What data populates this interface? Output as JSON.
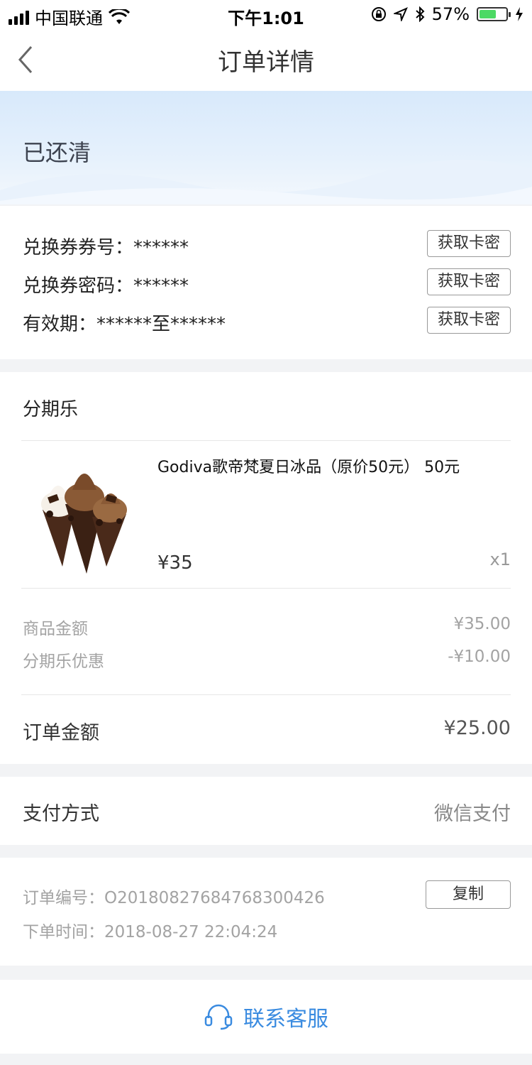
{
  "status_bar": {
    "carrier": "中国联通",
    "time": "下午1:01",
    "battery": "57%"
  },
  "nav": {
    "title": "订单详情"
  },
  "banner": {
    "status": "已还清"
  },
  "voucher": {
    "rows": [
      {
        "label": "兑换券券号：******",
        "button": "获取卡密"
      },
      {
        "label": "兑换券密码：******",
        "button": "获取卡密"
      },
      {
        "label": "有效期：******至******",
        "button": "获取卡密"
      }
    ]
  },
  "product_section": {
    "title": "分期乐",
    "product_name": "Godiva歌帝梵夏日冰品（原价50元） 50元",
    "price": "¥35",
    "quantity": "x1"
  },
  "summary": {
    "goods_amount_label": "商品金额",
    "goods_amount_value": "¥35.00",
    "discount_label": "分期乐优惠",
    "discount_value": "-¥10.00",
    "order_amount_label": "订单金额",
    "order_amount_value": "¥25.00"
  },
  "payment": {
    "label": "支付方式",
    "value": "微信支付"
  },
  "order_info": {
    "order_no": "订单编号：O20180827684768300426",
    "order_time": "下单时间：2018-08-27 22:04:24",
    "copy_button": "复制"
  },
  "contact": {
    "label": "联系客服"
  },
  "colors": {
    "accent": "#3a8be0",
    "banner": "#d8e9fb",
    "battery": "#4cd964"
  }
}
